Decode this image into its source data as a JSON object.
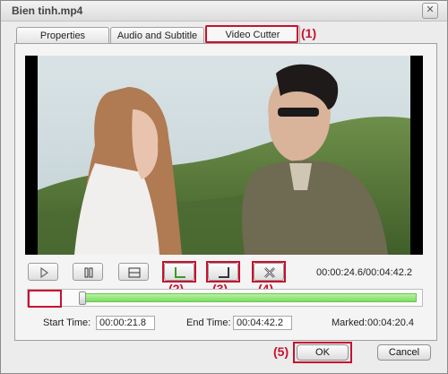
{
  "window": {
    "title": "Bien tinh.mp4"
  },
  "tabs": [
    {
      "label": "Properties"
    },
    {
      "label": "Audio and Subtitle"
    },
    {
      "label": "Video Cutter"
    }
  ],
  "annotations": {
    "a1": "(1)",
    "a2": "(2)",
    "a3": "(3)",
    "a4": "(4)",
    "a5": "(5)"
  },
  "controls": {
    "icons": [
      "play-icon",
      "pause-icon",
      "stop-icon",
      "mark-start-icon",
      "mark-end-icon",
      "delete-segment-icon"
    ]
  },
  "playback": {
    "timecode": "00:00:24.6/00:04:42.2",
    "position_fraction": 0.087
  },
  "cut": {
    "start_label": "Start Time:",
    "start_value": "00:00:21.8",
    "end_label": "End Time:",
    "end_value": "00:04:42.2",
    "marked_label": "Marked:",
    "marked_value": "00:04:20.4"
  },
  "buttons": {
    "ok": "OK",
    "cancel": "Cancel"
  },
  "colors": {
    "highlight": "#c8102e",
    "timeline_fill": "#7ddc62"
  }
}
